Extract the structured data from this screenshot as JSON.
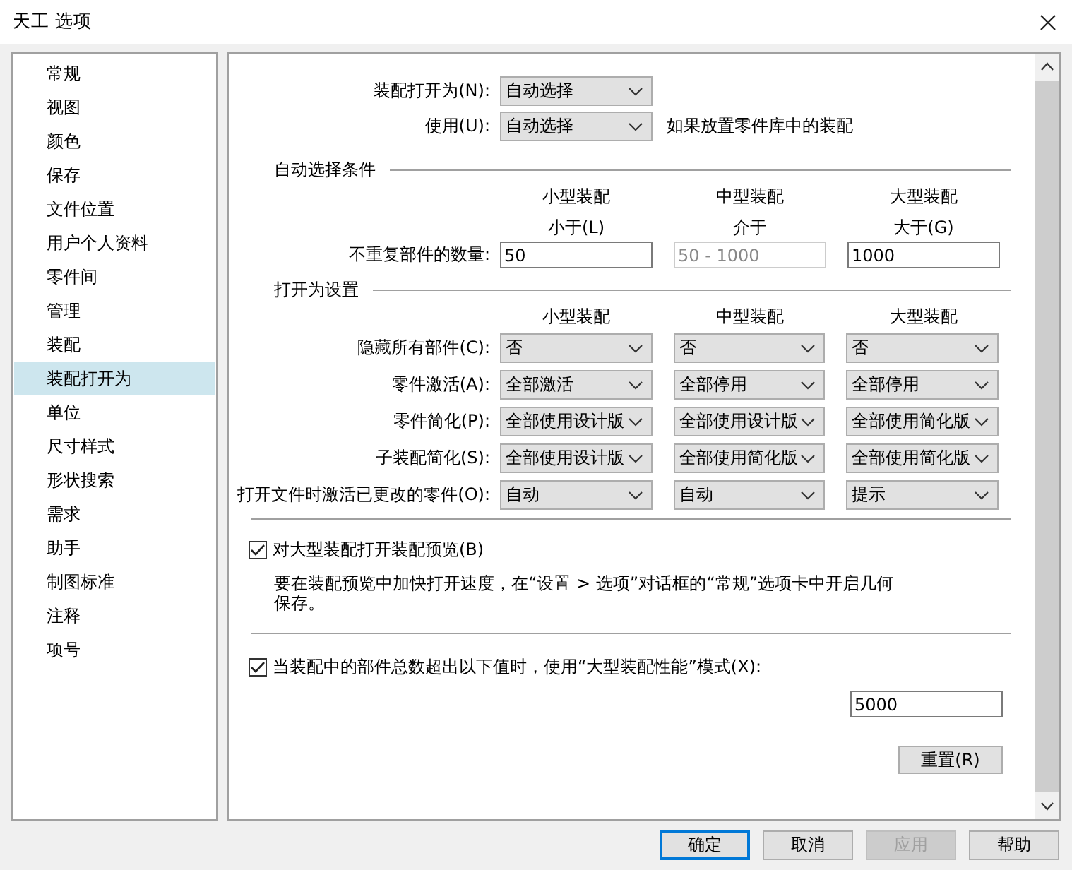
{
  "window": {
    "title": "天工 选项"
  },
  "sidebar": {
    "items": [
      {
        "label": "常规",
        "selected": false
      },
      {
        "label": "视图",
        "selected": false
      },
      {
        "label": "颜色",
        "selected": false
      },
      {
        "label": "保存",
        "selected": false
      },
      {
        "label": "文件位置",
        "selected": false
      },
      {
        "label": "用户个人资料",
        "selected": false
      },
      {
        "label": "零件间",
        "selected": false
      },
      {
        "label": "管理",
        "selected": false
      },
      {
        "label": "装配",
        "selected": false
      },
      {
        "label": "装配打开为",
        "selected": true
      },
      {
        "label": "单位",
        "selected": false
      },
      {
        "label": "尺寸样式",
        "selected": false
      },
      {
        "label": "形状搜索",
        "selected": false
      },
      {
        "label": "需求",
        "selected": false
      },
      {
        "label": "助手",
        "selected": false
      },
      {
        "label": "制图标准",
        "selected": false
      },
      {
        "label": "注释",
        "selected": false
      },
      {
        "label": "项号",
        "selected": false
      }
    ]
  },
  "top_fields": [
    {
      "label": "装配打开为(N):",
      "value": "自动选择"
    },
    {
      "label": "使用(U):",
      "value": "自动选择",
      "note": "如果放置零件库中的装配"
    }
  ],
  "auto_select": {
    "title": "自动选择条件",
    "columns": [
      {
        "name": "小型装配",
        "sub": "小于(L)"
      },
      {
        "name": "中型装配",
        "sub": "介于"
      },
      {
        "name": "大型装配",
        "sub": "大于(G)"
      }
    ],
    "row_label": "不重复部件的数量:",
    "values": [
      {
        "value": "50",
        "disabled": false
      },
      {
        "value": "50 - 1000",
        "disabled": true
      },
      {
        "value": "1000",
        "disabled": false
      }
    ]
  },
  "open_settings": {
    "title": "打开为设置",
    "columns": [
      "小型装配",
      "中型装配",
      "大型装配"
    ],
    "rows": [
      {
        "label": "隐藏所有部件(C):",
        "values": [
          "否",
          "否",
          "否"
        ]
      },
      {
        "label": "零件激活(A):",
        "values": [
          "全部激活",
          "全部停用",
          "全部停用"
        ]
      },
      {
        "label": "零件简化(P):",
        "values": [
          "全部使用设计版",
          "全部使用设计版",
          "全部使用简化版"
        ]
      },
      {
        "label": "子装配简化(S):",
        "values": [
          "全部使用设计版",
          "全部使用简化版",
          "全部使用简化版"
        ]
      },
      {
        "label": "打开文件时激活已更改的零件(O):",
        "values": [
          "自动",
          "自动",
          "提示"
        ]
      }
    ]
  },
  "preview": {
    "label": "对大型装配打开装配预览(B)",
    "checked": true,
    "note": "要在装配预览中加快打开速度，在“设置 > 选项”对话框的“常规”选项卡中开启几何保存。"
  },
  "large_mode": {
    "label": "当装配中的部件总数超出以下值时，使用“大型装配性能”模式(X):",
    "checked": true,
    "value": "5000"
  },
  "reset_button": "重置(R)",
  "buttons": [
    {
      "label": "确定",
      "default": true,
      "disabled": false
    },
    {
      "label": "取消",
      "default": false,
      "disabled": false
    },
    {
      "label": "应用",
      "default": false,
      "disabled": true
    },
    {
      "label": "帮助",
      "default": false,
      "disabled": false
    }
  ]
}
